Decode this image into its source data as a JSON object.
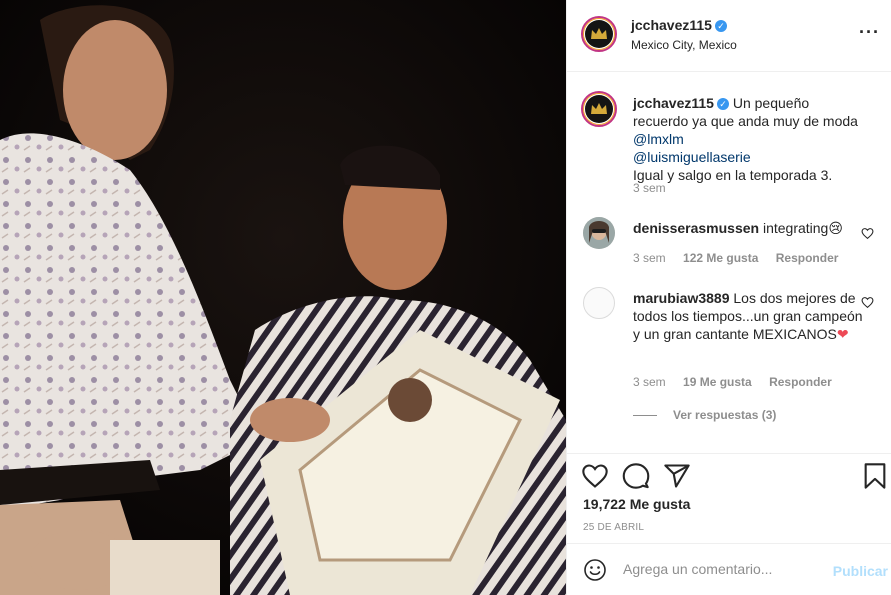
{
  "post": {
    "image_alt": "",
    "author": {
      "username": "jcchavez115",
      "location": "Mexico City, Mexico",
      "verified": true
    },
    "more_icon": "more-horizontal-icon",
    "caption": {
      "username": "jcchavez115",
      "text_1": "Un pequeño recuerdo ya que anda muy de moda ",
      "mention_1": "@lmxlm",
      "mention_2": "@luismiguellaserie",
      "text_2": "Igual y salgo en la temporada 3.",
      "time": "3 sem"
    },
    "comments": [
      {
        "username": "denisserasmussen",
        "text": "integrating",
        "emoji": "😢",
        "time": "3 sem",
        "likes": "122 Me gusta",
        "reply": "Responder"
      },
      {
        "username": "marubiaw3889",
        "text": "Los dos mejores de todos los tiempos...un gran campeón y un gran cantante MEXICANOS",
        "emoji": "❤",
        "time": "3 sem",
        "likes": "19 Me gusta",
        "reply": "Responder"
      }
    ],
    "view_replies": "Ver respuestas (3)",
    "likes_count": "19,722 Me gusta",
    "date": "25 DE ABRIL",
    "add_comment": {
      "placeholder": "Agrega un comentario...",
      "publish": "Publicar"
    },
    "icons": {
      "like": "heart-icon",
      "comment": "comment-icon",
      "share": "send-icon",
      "save": "bookmark-icon",
      "emoji": "emoji-smile-icon"
    },
    "colors": {
      "verified": "#3897f0",
      "mention": "#00376b",
      "publish_disabled": "#b2dffc",
      "heart_emoji": "#ed4956"
    }
  }
}
